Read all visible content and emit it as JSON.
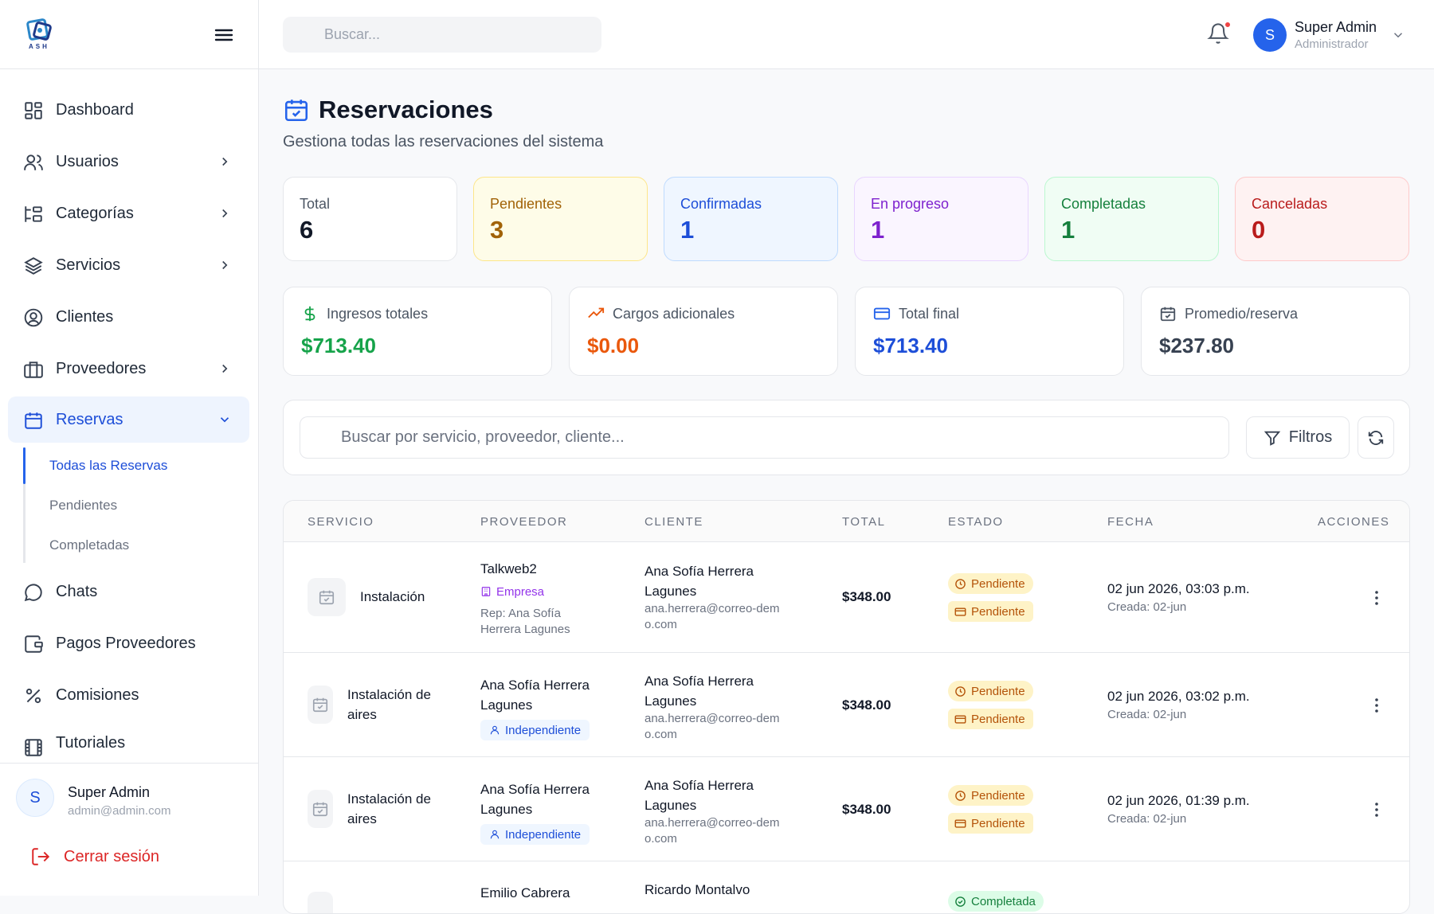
{
  "sidebar": {
    "nav": [
      {
        "label": "Dashboard",
        "icon": "dashboard-icon"
      },
      {
        "label": "Usuarios",
        "icon": "users-icon"
      },
      {
        "label": "Categorías",
        "icon": "categories-icon"
      },
      {
        "label": "Servicios",
        "icon": "layers-icon"
      },
      {
        "label": "Clientes",
        "icon": "user-circle-icon"
      },
      {
        "label": "Proveedores",
        "icon": "briefcase-icon"
      },
      {
        "label": "Reservas",
        "icon": "calendar-icon"
      },
      {
        "label": "Chats",
        "icon": "chat-icon"
      },
      {
        "label": "Pagos Proveedores",
        "icon": "wallet-icon"
      },
      {
        "label": "Comisiones",
        "icon": "percent-icon"
      },
      {
        "label": "Tutoriales",
        "icon": "film-icon"
      }
    ],
    "reservas_sub": [
      "Todas las Reservas",
      "Pendientes",
      "Completadas"
    ],
    "footer": {
      "avatar": "S",
      "name": "Super Admin",
      "email": "admin@admin.com",
      "logout": "Cerrar sesión"
    },
    "logo_text": "ASH"
  },
  "topbar": {
    "search_placeholder": "Buscar...",
    "user": {
      "avatar": "S",
      "name": "Super Admin",
      "role": "Administrador"
    }
  },
  "page": {
    "title": "Reservaciones",
    "subtitle": "Gestiona todas las reservaciones del sistema"
  },
  "stats": [
    {
      "label": "Total",
      "value": "6"
    },
    {
      "label": "Pendientes",
      "value": "3"
    },
    {
      "label": "Confirmadas",
      "value": "1"
    },
    {
      "label": "En progreso",
      "value": "1"
    },
    {
      "label": "Completadas",
      "value": "1"
    },
    {
      "label": "Canceladas",
      "value": "0"
    }
  ],
  "money": [
    {
      "label": "Ingresos totales",
      "value": "$713.40",
      "icon": "dollar-icon"
    },
    {
      "label": "Cargos adicionales",
      "value": "$0.00",
      "icon": "trending-up-icon"
    },
    {
      "label": "Total final",
      "value": "$713.40",
      "icon": "credit-card-icon"
    },
    {
      "label": "Promedio/reserva",
      "value": "$237.80",
      "icon": "calendar-check-icon"
    }
  ],
  "filters": {
    "search_placeholder": "Buscar por servicio, proveedor, cliente...",
    "filter_label": "Filtros"
  },
  "table": {
    "headers": [
      "SERVICIO",
      "PROVEEDOR",
      "CLIENTE",
      "TOTAL",
      "ESTADO",
      "FECHA",
      "ACCIONES"
    ],
    "rows": [
      {
        "service": "Instalación",
        "provider": "Talkweb2",
        "provider_tag": "Empresa",
        "provider_rep": "Rep: Ana Sofía Herrera Lagunes",
        "client_name": "Ana Sofía Herrera Lagunes",
        "client_email": "ana.herrera@correo-demo.com",
        "total": "$348.00",
        "status": "Pendiente",
        "payment": "Pendiente",
        "date": "02 jun 2026, 03:03 p.m.",
        "created": "Creada: 02-jun"
      },
      {
        "service": "Instalación de aires",
        "provider": "Ana Sofía Herrera Lagunes",
        "provider_tag": "Independiente",
        "client_name": "Ana Sofía Herrera Lagunes",
        "client_email": "ana.herrera@correo-demo.com",
        "total": "$348.00",
        "status": "Pendiente",
        "payment": "Pendiente",
        "date": "02 jun 2026, 03:02 p.m.",
        "created": "Creada: 02-jun"
      },
      {
        "service": "Instalación de aires",
        "provider": "Ana Sofía Herrera Lagunes",
        "provider_tag": "Independiente",
        "client_name": "Ana Sofía Herrera Lagunes",
        "client_email": "ana.herrera@correo-demo.com",
        "total": "$348.00",
        "status": "Pendiente",
        "payment": "Pendiente",
        "date": "02 jun 2026, 01:39 p.m.",
        "created": "Creada: 02-jun"
      },
      {
        "provider": "Emilio Cabrera",
        "client_name": "Ricardo Montalvo",
        "status": "Completada"
      }
    ]
  },
  "colors": {
    "primary": "#2563eb",
    "pending_bg": "#fefce8",
    "pending_text": "#a16207",
    "confirmed_bg": "#eff6ff",
    "progress_bg": "#faf5ff",
    "completed_bg": "#f0fdf4",
    "cancelled_bg": "#fef2f2",
    "danger": "#dc2626"
  }
}
